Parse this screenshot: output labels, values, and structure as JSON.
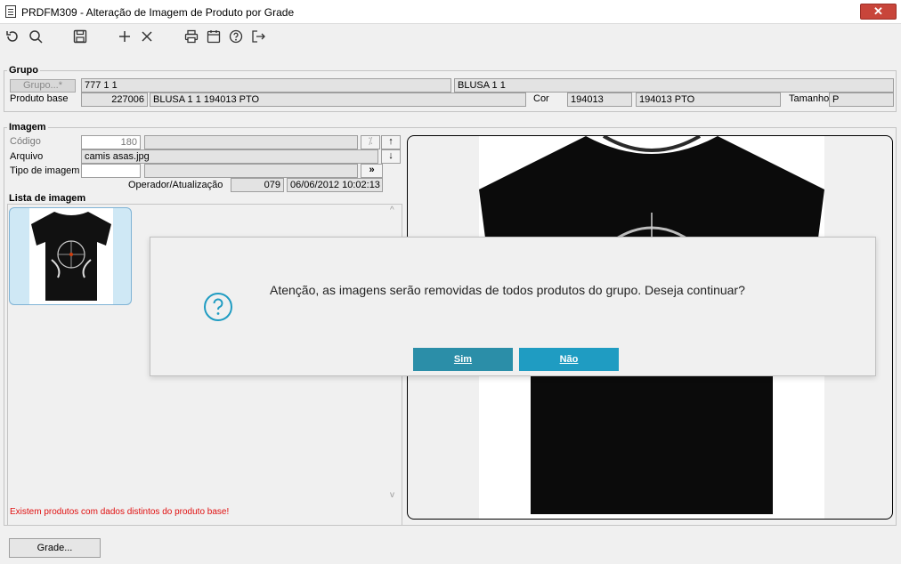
{
  "window": {
    "title": "PRDFM309 - Alteração de Imagem de Produto por Grade",
    "close_glyph": "✕"
  },
  "toolbar": {
    "icons": [
      "undo-icon",
      "search-icon",
      "save-icon",
      "add-icon",
      "delete-icon",
      "print-icon",
      "calendar-icon",
      "help-icon",
      "exit-icon"
    ]
  },
  "grupo": {
    "legend": "Grupo",
    "button_label": "Grupo...*",
    "code": "777 1 1",
    "name": "BLUSA 1 1",
    "produto_base_label": "Produto base",
    "produto_base_code": "227006",
    "produto_base_desc": "BLUSA 1 1 194013 PTO",
    "cor_label": "Cor",
    "cor_code": "194013",
    "cor_desc": "194013 PTO",
    "tamanho_label": "Tamanho",
    "tamanho_value": "P"
  },
  "imagem": {
    "legend": "Imagem",
    "codigo_label": "Código",
    "codigo_value": "180",
    "arquivo_label": "Arquivo",
    "arquivo_value": "camis asas.jpg",
    "tipo_label": "Tipo de imagem",
    "tipo_value": "",
    "operador_label": "Operador/Atualização",
    "operador_value": "079",
    "atualizacao_value": "06/06/2012 10:02:13",
    "browse_label": "»",
    "up_label": "↑",
    "down_label": "↓",
    "x_label": "⁒"
  },
  "lista": {
    "legend": "Lista de imagem",
    "scroll_up": "^",
    "scroll_down": "v",
    "warning": "Existem produtos com dados distintos do produto base!"
  },
  "footer": {
    "grade_button": "Grade..."
  },
  "dialog": {
    "message": "Atenção, as imagens serão removidas de todos produtos do grupo. Deseja continuar?",
    "yes_label": "Sim",
    "no_label": "Não",
    "accent": "#1f9cc2"
  }
}
